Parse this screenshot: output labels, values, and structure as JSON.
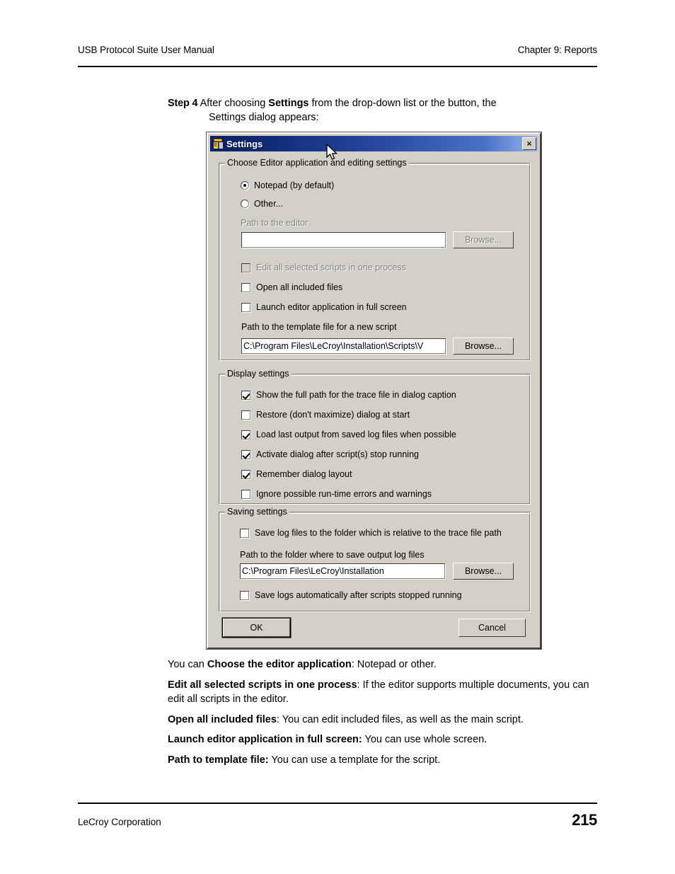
{
  "page": {
    "header_left": "USB Protocol Suite User Manual",
    "header_right": "Chapter 9: Reports",
    "footer_left": "LeCroy Corporation",
    "page_number": "215"
  },
  "step": {
    "label": "Step 4",
    "line1_a": "After choosing ",
    "line1_bold": "Settings",
    "line1_b": " from the drop-down list or the button, the",
    "line2": "Settings dialog appears:"
  },
  "dialog": {
    "title": "Settings",
    "icon": "script-settings-icon",
    "close_label": "×",
    "close_icon": "close-icon",
    "editor_group": {
      "title": "Choose Editor application and editing settings",
      "radio_notepad": {
        "label": "Notepad (by default)",
        "checked": true
      },
      "radio_other": {
        "label": "Other...",
        "checked": false
      },
      "path_editor_label": "Path to the editor",
      "path_editor_value": "",
      "path_editor_browse": "Browse...",
      "chk_edit_all": {
        "label": "Edit all selected scripts in one process",
        "checked": false,
        "disabled": true
      },
      "chk_open_included": {
        "label": "Open all included files",
        "checked": false,
        "disabled": false
      },
      "chk_full_screen": {
        "label": "Launch editor application in full screen",
        "checked": false,
        "disabled": false
      },
      "path_template_label": "Path to the template file for a new script",
      "path_template_value": "C:\\Program Files\\LeCroy\\Installation\\Scripts\\V",
      "path_template_browse": "Browse..."
    },
    "display_group": {
      "title": "Display settings",
      "items": [
        {
          "label": "Show the full path for the trace file in dialog caption",
          "checked": true
        },
        {
          "label": "Restore (don't maximize) dialog at start",
          "checked": false
        },
        {
          "label": "Load last output from saved log files when possible",
          "checked": true
        },
        {
          "label": "Activate dialog after script(s) stop running",
          "checked": true
        },
        {
          "label": "Remember dialog layout",
          "checked": true
        },
        {
          "label": "Ignore possible run-time errors and warnings",
          "checked": false
        }
      ]
    },
    "saving_group": {
      "title": "Saving settings",
      "chk_relative": {
        "label": "Save log files to the folder which is relative to the trace file path",
        "checked": false
      },
      "path_folder_label": "Path to the folder where to save output log files",
      "path_folder_value": "C:\\Program Files\\LeCroy\\Installation",
      "path_folder_browse": "Browse...",
      "chk_auto_save": {
        "label": "Save logs automatically after scripts stopped running",
        "checked": false
      }
    },
    "ok_label": "OK",
    "cancel_label": "Cancel"
  },
  "body": {
    "p1_a": "You can ",
    "p1_bold": "Choose the editor application",
    "p1_b": ": Notepad or other.",
    "p2_bold": "Edit all selected scripts in one process",
    "p2_text": ": If the editor supports multiple documents, you can edit all scripts in the editor.",
    "p3_bold": "Open all included files",
    "p3_text": ": You can edit included files, as well as the main script.",
    "p4_bold": "Launch editor application in full screen:",
    "p4_text": " You can use whole screen.",
    "p5_bold": "Path to template file:",
    "p5_text": " You can use a template for the script."
  },
  "colors": {
    "dialog_face": "#d4d0c8",
    "title_gradient_start": "#0a246a",
    "title_gradient_end": "#9ab6e8",
    "disabled_text": "#808080"
  }
}
